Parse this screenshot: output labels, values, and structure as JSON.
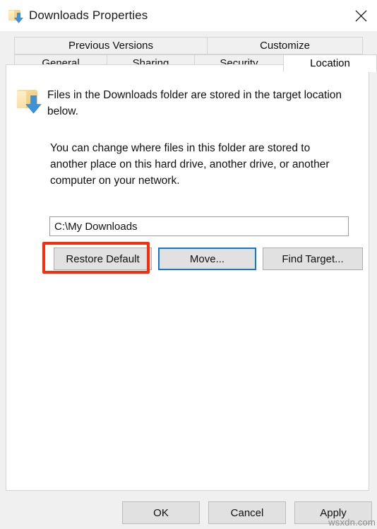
{
  "window": {
    "title": "Downloads Properties",
    "title_icon": "downloads-folder-icon",
    "close_label": "✕"
  },
  "tabs": {
    "top_row": [
      {
        "label": "Previous Versions",
        "selected": false
      },
      {
        "label": "Customize",
        "selected": false
      }
    ],
    "bottom_row": [
      {
        "label": "General",
        "selected": false
      },
      {
        "label": "Sharing",
        "selected": false
      },
      {
        "label": "Security",
        "selected": false
      },
      {
        "label": "Location",
        "selected": true
      }
    ]
  },
  "panel": {
    "lead_text": "Files in the Downloads folder are stored in the target location below.",
    "description": "You can change where files in this folder are stored to another place on this hard drive, another drive, or another computer on your network.",
    "path_input": {
      "value": "C:\\My Downloads",
      "placeholder": ""
    },
    "buttons": {
      "restore_default": "Restore Default",
      "move": "Move...",
      "find_target": "Find Target..."
    }
  },
  "footer": {
    "ok": "OK",
    "cancel": "Cancel",
    "apply": "Apply"
  },
  "annotation": {
    "highlight_target": "Restore Default",
    "highlight_color": "#fc2b09",
    "focus_color": "#1278c8"
  },
  "watermark": "wsxdn.com"
}
